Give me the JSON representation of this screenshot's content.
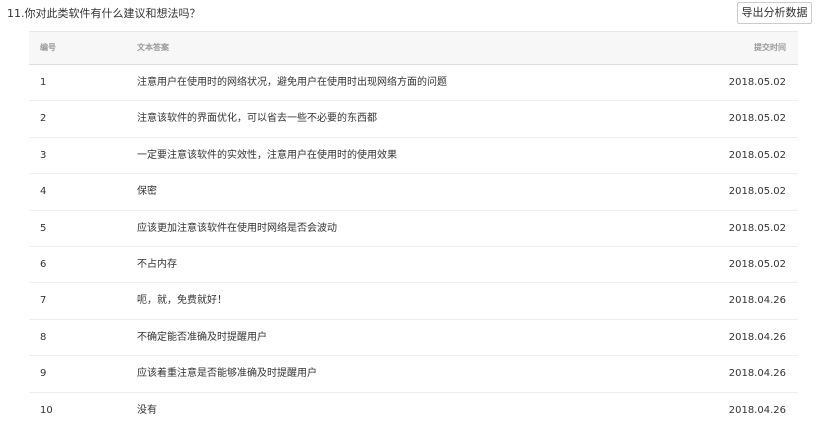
{
  "question": {
    "title": "11.你对此类软件有什么建议和想法吗？"
  },
  "toolbar": {
    "export_label": "导出分析数据"
  },
  "table": {
    "headers": {
      "id": "编号",
      "text": "文本答案",
      "time": "提交时间"
    },
    "rows": [
      {
        "id": "1",
        "text": "注意用户在使用时的网络状况，避免用户在使用时出现网络方面的问题",
        "time": "2018.05.02"
      },
      {
        "id": "2",
        "text": "注意该软件的界面优化，可以省去一些不必要的东西都",
        "time": "2018.05.02"
      },
      {
        "id": "3",
        "text": "一定要注意该软件的实效性，注意用户在使用时的使用效果",
        "time": "2018.05.02"
      },
      {
        "id": "4",
        "text": "保密",
        "time": "2018.05.02"
      },
      {
        "id": "5",
        "text": "应该更加注意该软件在使用时网络是否会波动",
        "time": "2018.05.02"
      },
      {
        "id": "6",
        "text": "不占内存",
        "time": "2018.05.02"
      },
      {
        "id": "7",
        "text": "呃，就，免费就好！",
        "time": "2018.04.26"
      },
      {
        "id": "8",
        "text": "不确定能否准确及时提醒用户",
        "time": "2018.04.26"
      },
      {
        "id": "9",
        "text": "应该着重注意是否能够准确及时提醒用户",
        "time": "2018.04.26"
      },
      {
        "id": "10",
        "text": "没有",
        "time": "2018.04.26"
      }
    ]
  }
}
